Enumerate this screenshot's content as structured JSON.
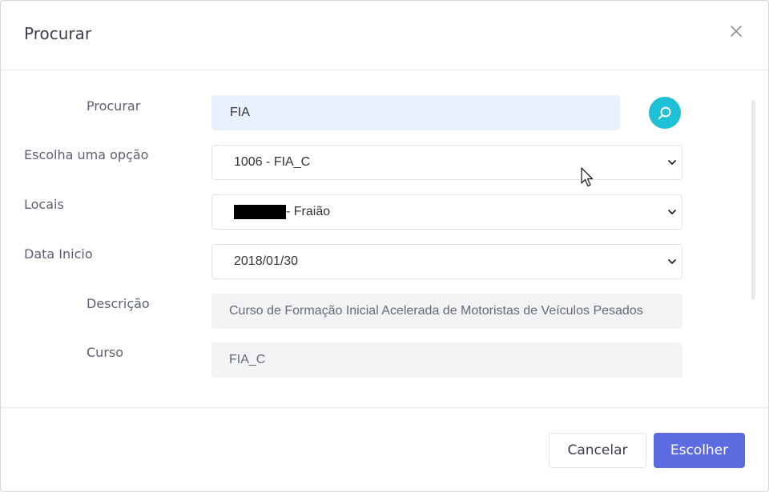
{
  "dialog": {
    "title": "Procurar",
    "close_icon": "close-icon"
  },
  "form": {
    "search": {
      "label": "Procurar",
      "value": "FIA",
      "button_icon": "search-icon"
    },
    "option": {
      "label": "Escolha uma opção",
      "selected": "1006 - FIA_C"
    },
    "locais": {
      "label": "Locais",
      "selected": "- Fraião"
    },
    "data_inicio": {
      "label": "Data Inicio",
      "selected": "2018/01/30"
    },
    "descricao": {
      "label": "Descrição",
      "value": "Curso de Formação Inicial Acelerada de Motoristas de Veículos Pesados"
    },
    "curso": {
      "label": "Curso",
      "value": "FIA_C"
    }
  },
  "footer": {
    "cancel_label": "Cancelar",
    "choose_label": "Escolher"
  },
  "colors": {
    "primary": "#5c6bdf",
    "search_button": "#1ec0d6",
    "search_input_bg": "#e8f0fe",
    "readonly_bg": "#f2f3f5"
  }
}
